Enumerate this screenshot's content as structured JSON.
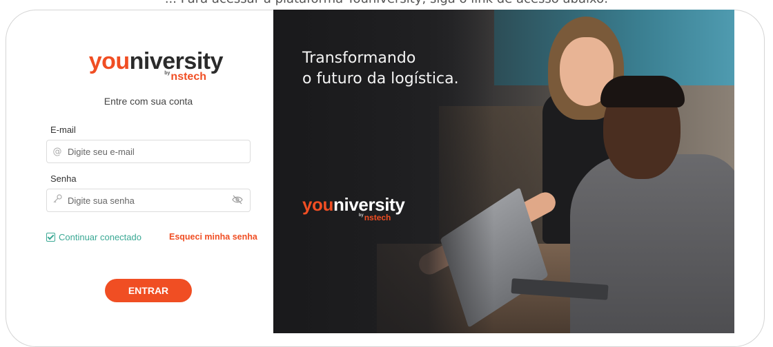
{
  "caption": "... Para acessar a plataforma Youniversity, siga o link de acesso abaixo:",
  "logo": {
    "you": "you",
    "rest": "niversity",
    "by": "by",
    "brand": "nstech"
  },
  "login": {
    "subtitle": "Entre com sua conta",
    "email_label": "E-mail",
    "email_placeholder": "Digite seu e-mail",
    "password_label": "Senha",
    "password_placeholder": "Digite sua senha",
    "remember_label": "Continuar conectado",
    "forgot_label": "Esqueci minha senha",
    "submit_label": "ENTRAR"
  },
  "hero": {
    "headline_line1": "Transformando",
    "headline_line2": "o futuro da logística."
  },
  "colors": {
    "accent": "#f04e23",
    "success": "#3aa894"
  }
}
